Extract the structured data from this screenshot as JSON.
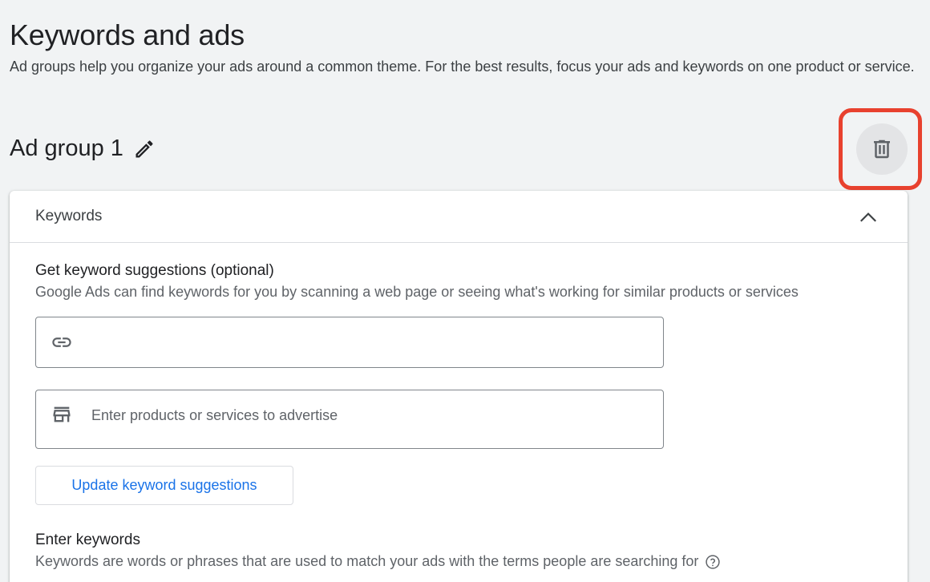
{
  "header": {
    "title": "Keywords and ads",
    "description": "Ad groups help you organize your ads around a common theme. For the best results, focus your ads and keywords on one product or service."
  },
  "ad_group": {
    "name": "Ad group 1",
    "edit_icon": "pencil-icon",
    "delete_icon": "trash-icon",
    "highlight_color": "#e8412e"
  },
  "keywords_panel": {
    "header_label": "Keywords",
    "collapse_icon": "chevron-up-icon",
    "suggestions": {
      "title": "Get keyword suggestions (optional)",
      "description": "Google Ads can find keywords for you by scanning a web page or seeing what's working for similar products or services",
      "url_input": {
        "icon": "link-icon",
        "value": "",
        "placeholder": ""
      },
      "products_input": {
        "icon": "store-icon",
        "value": "",
        "placeholder": "Enter products or services to advertise"
      },
      "update_button_label": "Update keyword suggestions"
    },
    "enter_keywords": {
      "title": "Enter keywords",
      "description": "Keywords are words or phrases that are used to match your ads with the terms people are searching for",
      "help_icon": "help-circle-icon"
    }
  },
  "colors": {
    "accent": "#1a73e8",
    "background": "#f1f3f4"
  }
}
